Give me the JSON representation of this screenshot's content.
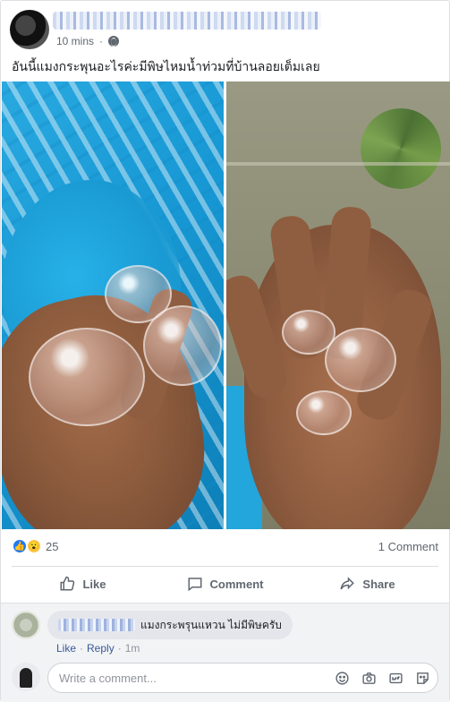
{
  "post": {
    "timestamp": "10 mins",
    "text": "อันนี้แมงกระพุนอะไรค่ะมีพิษไหมน้ำท่วมที่บ้านลอยเต็มเลย"
  },
  "reactions": {
    "count": "25",
    "comments_label": "1 Comment"
  },
  "actions": {
    "like": "Like",
    "comment": "Comment",
    "share": "Share"
  },
  "comment": {
    "text": "แมงกระพรุนแหวน ไม่มีพิษครับ",
    "like": "Like",
    "reply": "Reply",
    "time": "1m"
  },
  "write_comment": {
    "placeholder": "Write a comment..."
  },
  "colors": {
    "accent": "#385898",
    "like_blue": "#2078f4",
    "wow_yellow": "#f7c84a"
  }
}
